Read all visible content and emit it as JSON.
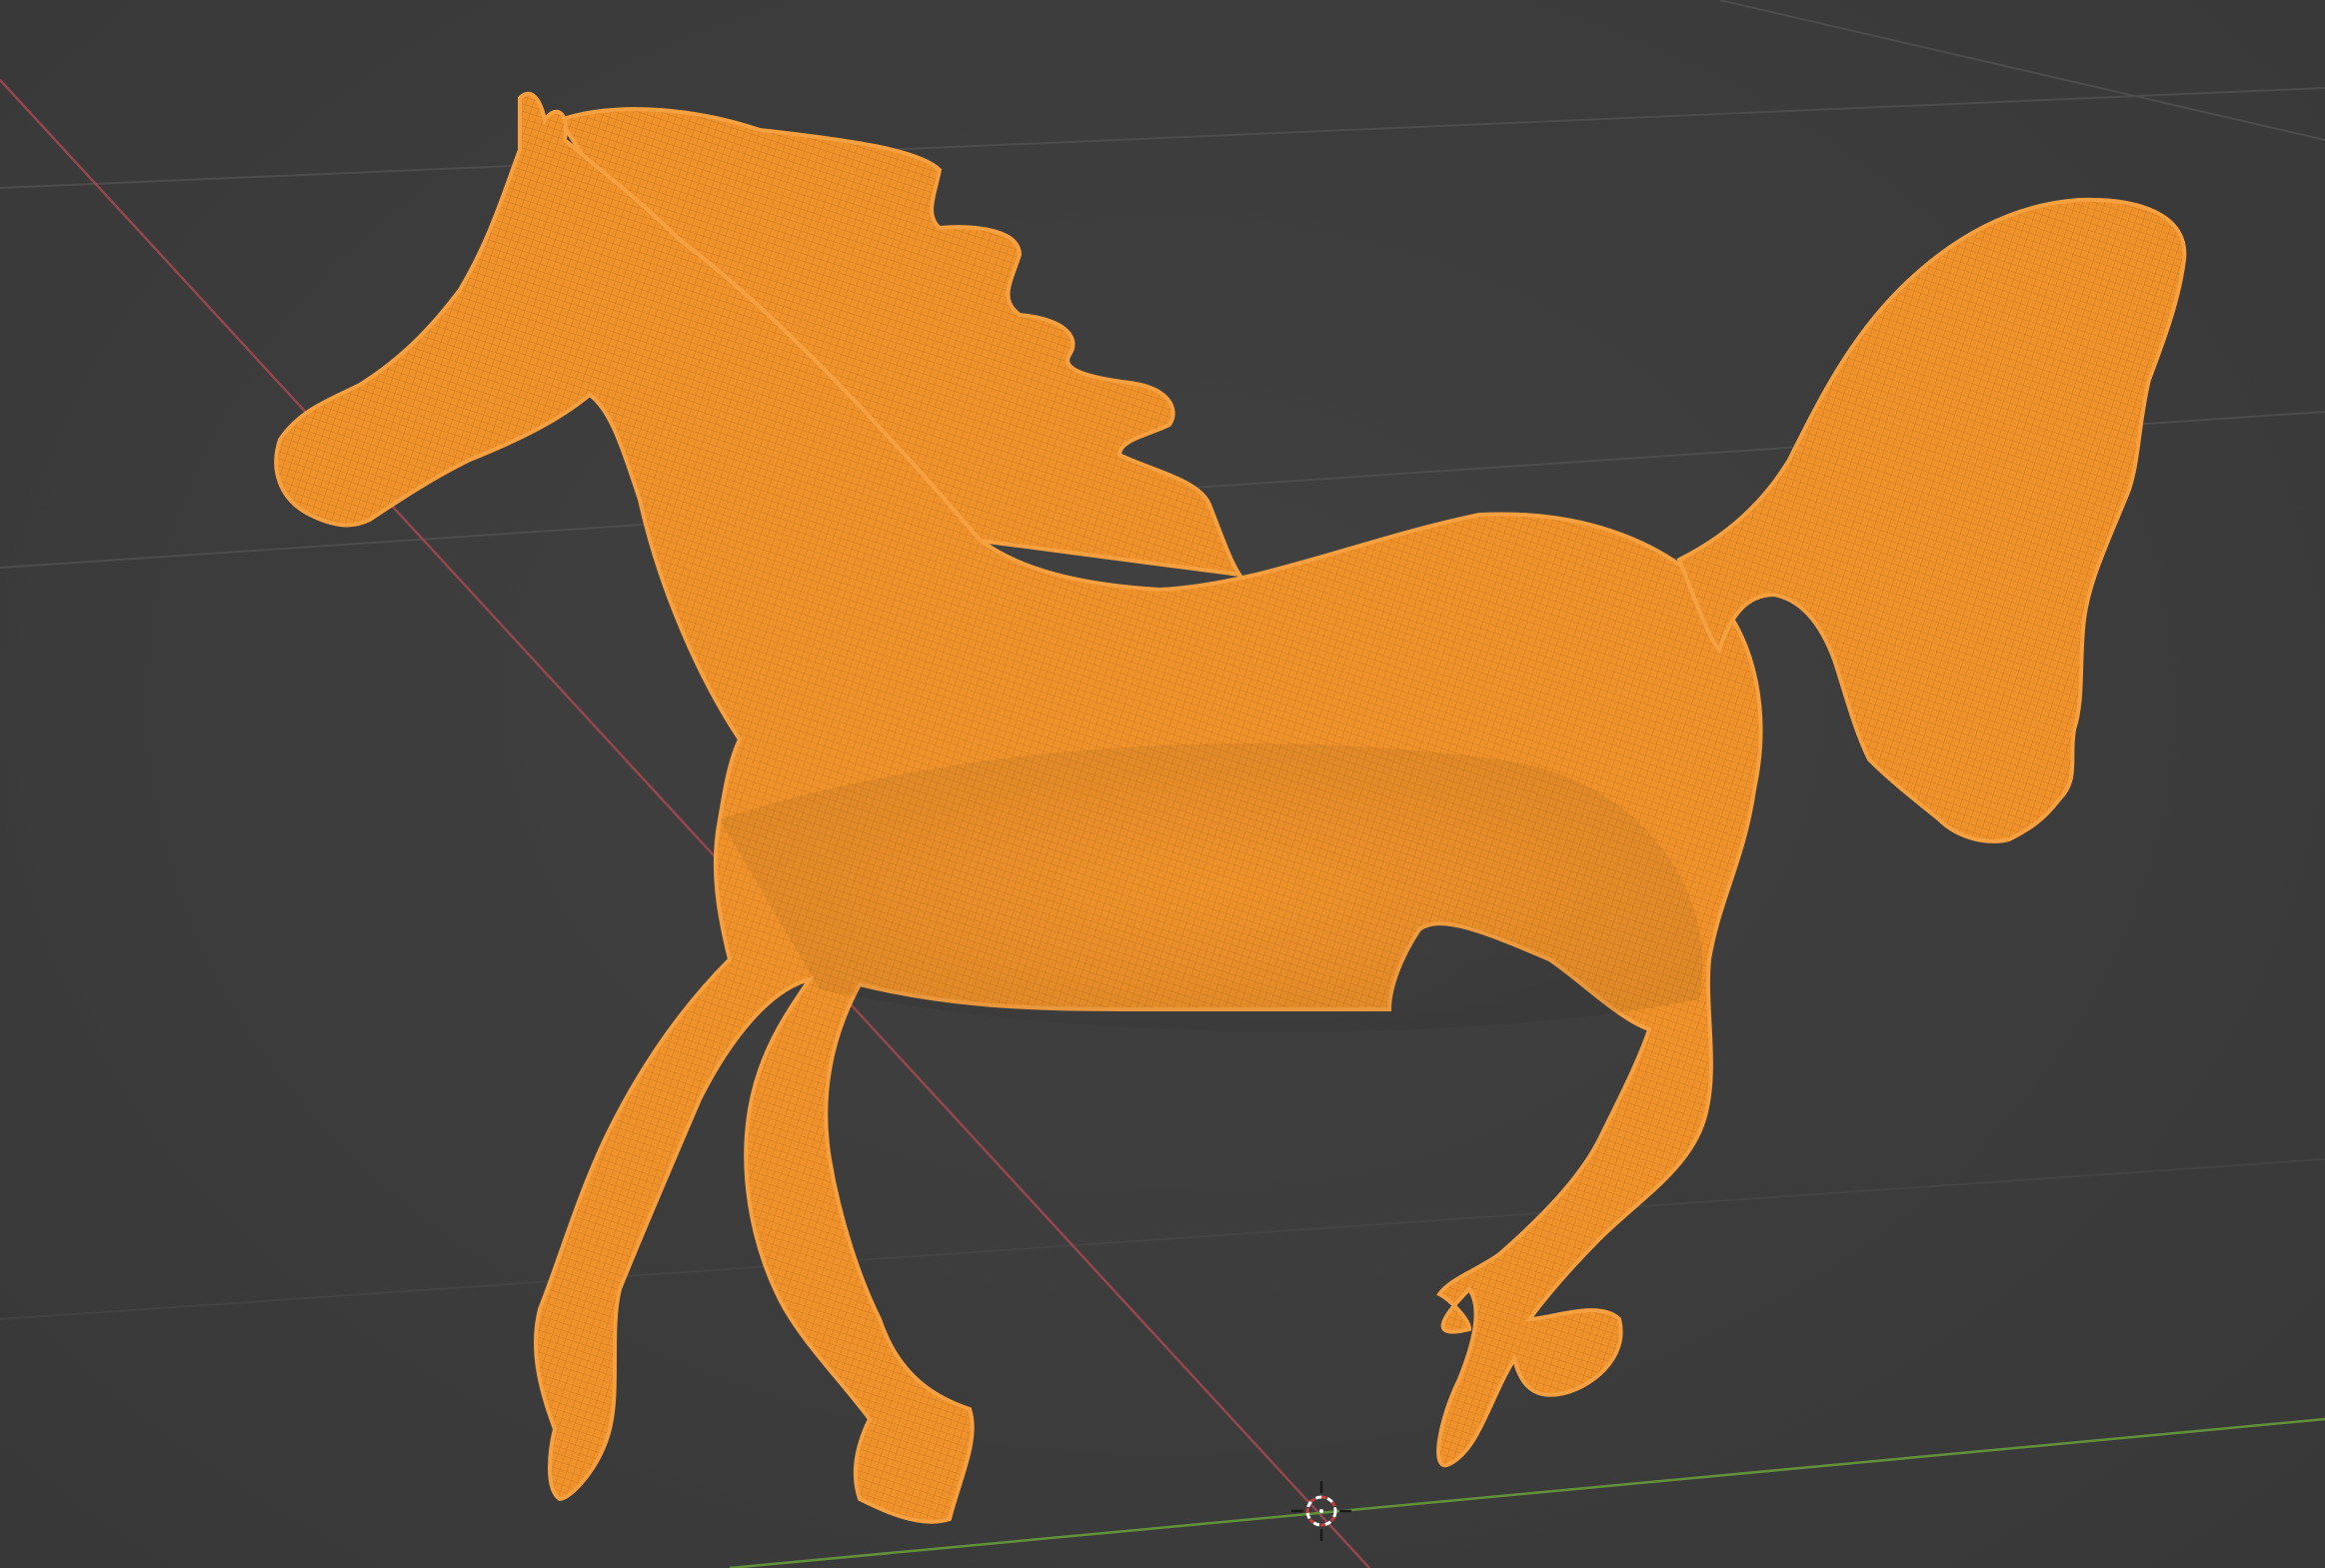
{
  "viewport": {
    "background_color": "#3d3d3d",
    "grid_color": "#4a4a4a",
    "x_axis_color": "#9a4b53",
    "y_axis_color": "#6a9a3c",
    "object": {
      "type": "mesh",
      "subject": "horse",
      "display": "wireframe",
      "selected": true,
      "selection_color": "#f5952b"
    },
    "cursor": {
      "icon": "3d-cursor-icon"
    }
  }
}
